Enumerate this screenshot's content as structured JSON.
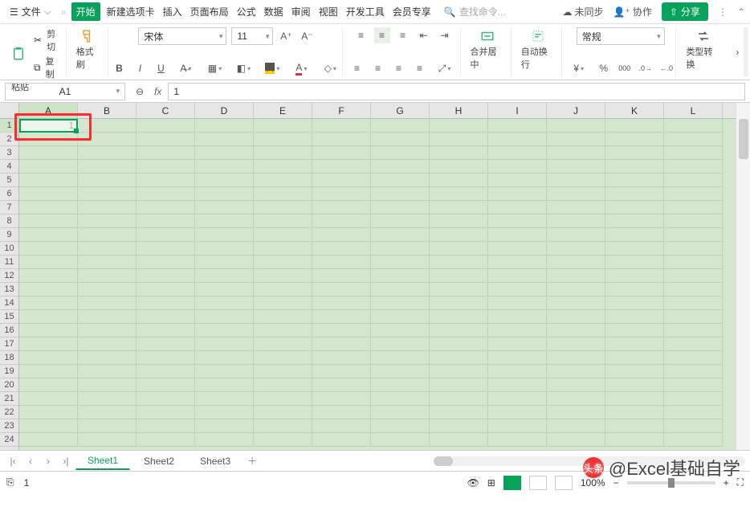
{
  "menu": {
    "file": "文件",
    "tabs": [
      "开始",
      "新建选项卡",
      "插入",
      "页面布局",
      "公式",
      "数据",
      "审阅",
      "视图",
      "开发工具",
      "会员专享"
    ],
    "search_placeholder": "查找命令...",
    "sync": "未同步",
    "coop": "协作",
    "share": "分享"
  },
  "toolbar": {
    "cut": "剪切",
    "copy": "复制",
    "paste": "粘贴",
    "formatpainter": "格式刷",
    "font": "宋体",
    "fontsize": "11",
    "merge": "合并居中",
    "wrap": "自动换行",
    "numfmt": "常规",
    "convert": "类型转换"
  },
  "fbar": {
    "name": "A1",
    "formula": "1"
  },
  "grid": {
    "cols": [
      "A",
      "B",
      "C",
      "D",
      "E",
      "F",
      "G",
      "H",
      "I",
      "J",
      "K",
      "L"
    ],
    "rows": 24,
    "a1": "1"
  },
  "sheets": {
    "items": [
      "Sheet1",
      "Sheet2",
      "Sheet3"
    ],
    "active": 0
  },
  "status": {
    "left": "1",
    "zoom": "100%"
  },
  "watermark": {
    "prefix": "头条",
    "text": "@Excel基础自学"
  }
}
